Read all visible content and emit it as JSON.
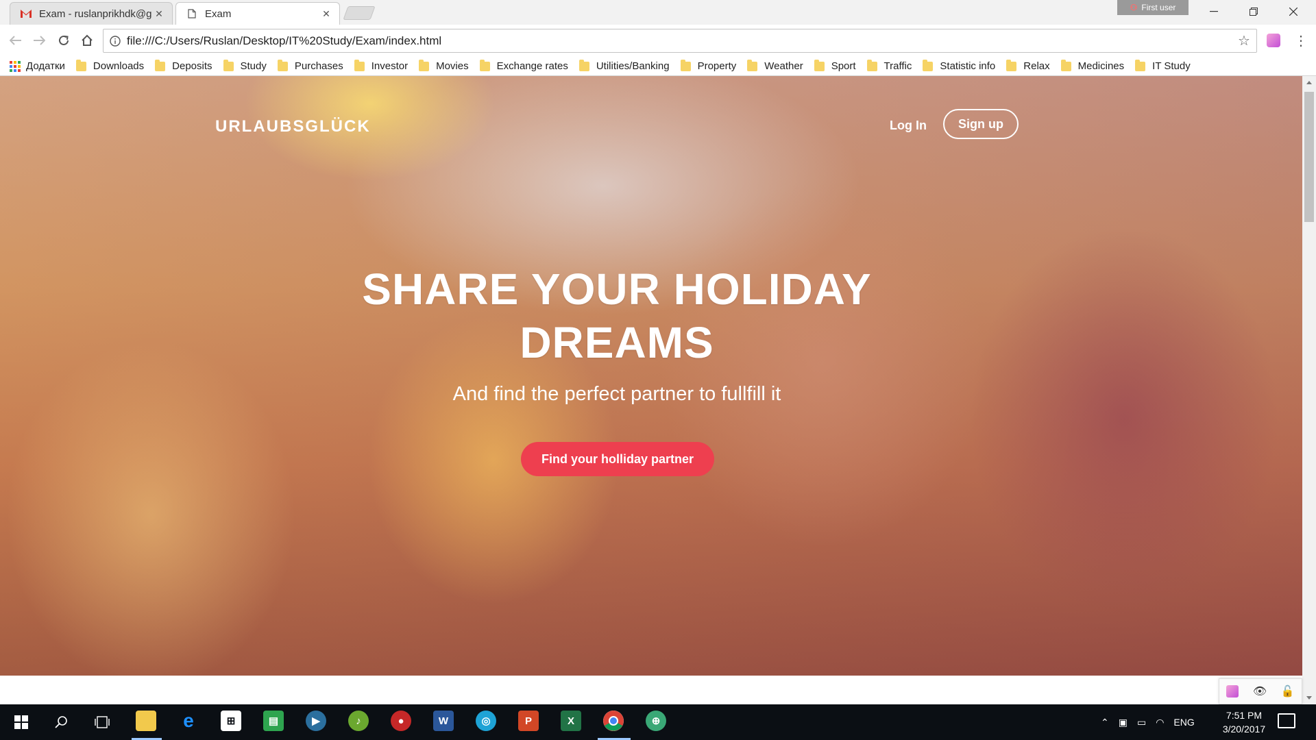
{
  "browser": {
    "tabs": [
      {
        "title": "Exam - ruslanprikhdk@g",
        "favicon": "gmail-icon",
        "active": false
      },
      {
        "title": "Exam",
        "favicon": "page-icon",
        "active": true
      }
    ],
    "profile_name": "First user",
    "url": "file:///C:/Users/Ruslan/Desktop/IT%20Study/Exam/index.html",
    "bookmarks": {
      "apps_label": "Додатки",
      "items": [
        "Downloads",
        "Deposits",
        "Study",
        "Purchases",
        "Investor",
        "Movies",
        "Exchange rates",
        "Utilities/Banking",
        "Property",
        "Weather",
        "Sport",
        "Traffic",
        "Statistic info",
        "Relax",
        "Medicines",
        "IT Study"
      ]
    }
  },
  "page": {
    "logo": "URLAUBSGLÜCK",
    "nav": {
      "login": "Log In",
      "signup": "Sign up"
    },
    "hero": {
      "headline": "SHARE YOUR HOLIDAY DREAMS",
      "subheadline": "And find the perfect partner to fullfill it",
      "cta": "Find your holliday partner"
    }
  },
  "taskbar": {
    "apps": [
      "file-explorer-icon",
      "edge-icon",
      "store-icon",
      "sheets-icon",
      "media-icon",
      "music-icon",
      "screen-recorder-icon",
      "word-icon",
      "disc-icon",
      "powerpoint-icon",
      "excel-icon",
      "chrome-icon",
      "globe-icon"
    ],
    "language": "ENG",
    "time": "7:51 PM",
    "date": "3/20/2017"
  },
  "colors": {
    "cta": "#ee3f4f",
    "taskbar": "#0b0f14",
    "folder": "#f6d365"
  }
}
